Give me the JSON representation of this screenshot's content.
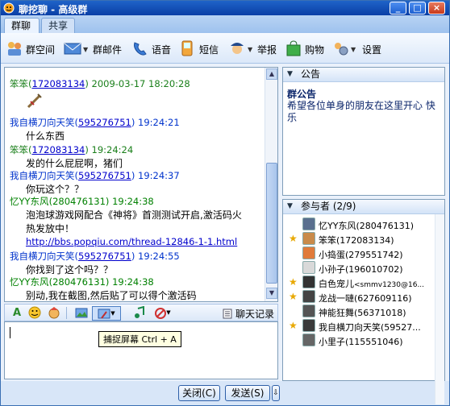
{
  "window": {
    "title": "聊挖聊  -  高级群",
    "buttons": {
      "minimize": "_",
      "maximize": "□",
      "close": "×"
    }
  },
  "tabs": [
    {
      "label": "群聊",
      "active": true
    },
    {
      "label": "共享",
      "active": false
    }
  ],
  "toolbar": {
    "items": [
      {
        "label": "群空间",
        "icon": "house-people-icon"
      },
      {
        "label": "群邮件",
        "icon": "envelope-icon"
      },
      {
        "label": "语音",
        "icon": "phone-icon"
      },
      {
        "label": "短信",
        "icon": "mobile-icon"
      },
      {
        "label": "举报",
        "icon": "police-icon"
      },
      {
        "label": "购物",
        "icon": "shopping-bag-icon"
      },
      {
        "label": "设置",
        "icon": "settings-people-icon"
      }
    ]
  },
  "chat": {
    "lines": [
      {
        "type": "header",
        "name": "笨笨",
        "uid": "172083134",
        "time": "2009-03-17 18:20:28",
        "color": "green"
      },
      {
        "type": "sword"
      },
      {
        "type": "header",
        "name": "我自横刀向天笑",
        "uid": "595276751",
        "time": "19:24:21",
        "color": "blue"
      },
      {
        "type": "text",
        "text": "什么东西"
      },
      {
        "type": "header",
        "name": "笨笨",
        "uid": "172083134",
        "time": "19:24:24",
        "color": "green"
      },
      {
        "type": "text",
        "text": "发的什么屁屁啊，猪们"
      },
      {
        "type": "header",
        "name": "我自横刀向天笑",
        "uid": "595276751",
        "time": "19:24:37",
        "color": "blue"
      },
      {
        "type": "text",
        "text": " 你玩这个？？"
      },
      {
        "type": "header2",
        "name": "忆YY东风",
        "uid": "280476131",
        "time": "19:24:38",
        "color": "darkgreen"
      },
      {
        "type": "text",
        "text": "泡泡球游戏网配合《神将》首测测试开启,激活码火"
      },
      {
        "type": "text",
        "text": "热发放中！"
      },
      {
        "type": "link",
        "text": "http://bbs.popqiu.com/thread-12846-1-1.html"
      },
      {
        "type": "header",
        "name": "我自横刀向天笑",
        "uid": "595276751",
        "time": "19:24:55",
        "color": "blue"
      },
      {
        "type": "text",
        "text": "你找到了这个吗？？"
      },
      {
        "type": "header2",
        "name": "忆YY东风",
        "uid": "280476131",
        "time": "19:24:38",
        "color": "darkgreen"
      },
      {
        "type": "text",
        "text": "别动,我在截图,然后贴了可以得个激活码"
      }
    ]
  },
  "input_toolbar": {
    "history_label": "聊天记录",
    "tooltip": "捕捉屏幕 Ctrl + A"
  },
  "buttons": {
    "close": "关闭(C)",
    "send": "发送(S)"
  },
  "notice_panel": {
    "header": "公告",
    "title": "群公告",
    "text": "希望各位单身的朋友在这里开心 快乐"
  },
  "members_panel": {
    "header": "参与者 (2/9)",
    "members": [
      {
        "name": "忆YY东风",
        "uid": "(280476131)",
        "admin": false
      },
      {
        "name": "笨笨",
        "uid": "(172083134)",
        "admin": true
      },
      {
        "name": "小捣蛋",
        "uid": "(279551742)",
        "admin": false
      },
      {
        "name": "小孙子",
        "uid": "(196010702)",
        "admin": false
      },
      {
        "name": "白色宠儿",
        "uid": "<smmv1230@16...",
        "admin": true
      },
      {
        "name": "龙战一嗹",
        "uid": "(627609116)",
        "admin": true
      },
      {
        "name": "神能狂舞",
        "uid": "(56371018)",
        "admin": false
      },
      {
        "name": "我自横刀向天笑",
        "uid": "(59527...",
        "admin": true
      },
      {
        "name": "小里子",
        "uid": "(115551046)",
        "admin": false
      }
    ]
  }
}
